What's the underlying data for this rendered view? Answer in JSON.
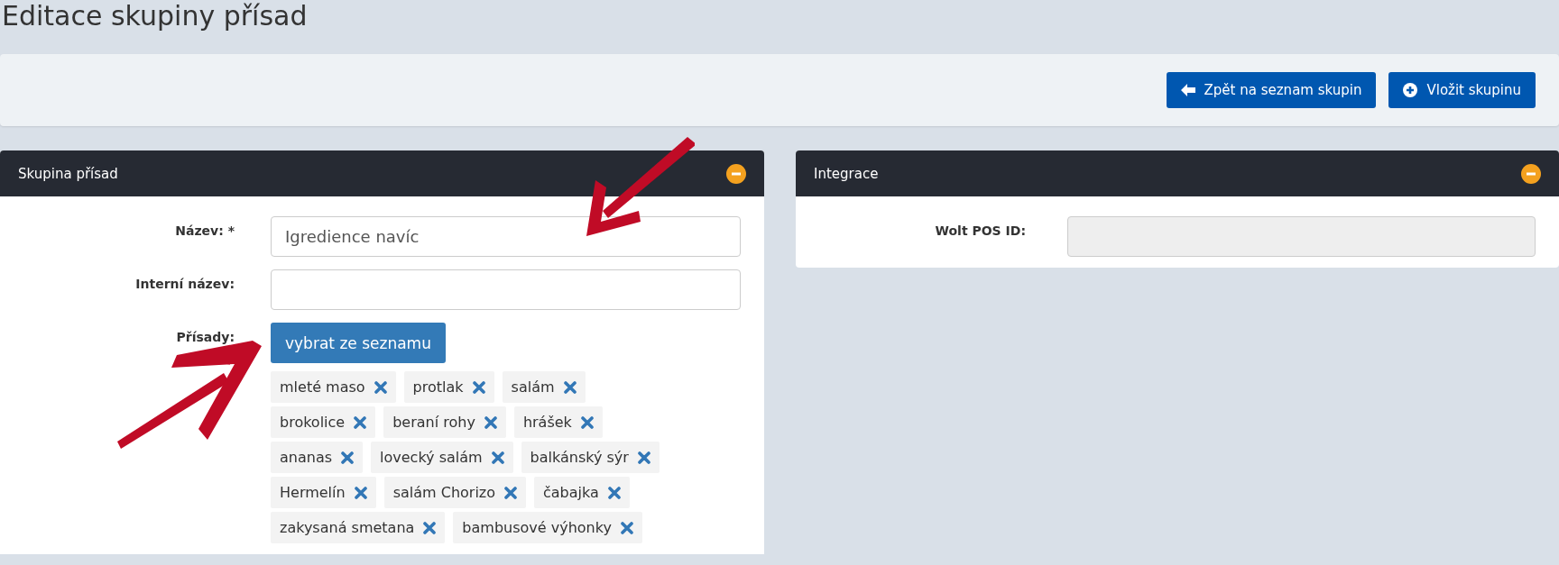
{
  "page_title": "Editace skupiny přísad",
  "toolbar": {
    "buttons": [
      {
        "label": "Zpět na seznam skupin",
        "kind": "back"
      },
      {
        "label": "Vložit skupinu",
        "kind": "add"
      }
    ]
  },
  "panels": [
    {
      "title": "Skupina přísad",
      "fields": [
        {
          "label": "Název: *",
          "kind": "text",
          "value": "Igredience navíc"
        },
        {
          "label": "Interní název:",
          "kind": "text"
        },
        {
          "label": "Přísady:",
          "kind": "picker",
          "button": "vybrat ze seznamu",
          "tags": [
            "mleté maso",
            "protlak",
            "salám",
            "brokolice",
            "beraní rohy",
            "hrášek",
            "ananas",
            "lovecký salám",
            "balkánský sýr",
            "Hermelín",
            "salám Chorizo",
            "čabajka",
            "zakysaná smetana",
            "bambusové výhonky"
          ]
        }
      ]
    },
    {
      "title": "Integrace",
      "fields": [
        {
          "label": "Wolt POS ID:",
          "kind": "text",
          "disabled": true
        }
      ]
    }
  ],
  "annotations": [
    {
      "kind": "arrow"
    },
    {
      "kind": "arrow"
    }
  ]
}
